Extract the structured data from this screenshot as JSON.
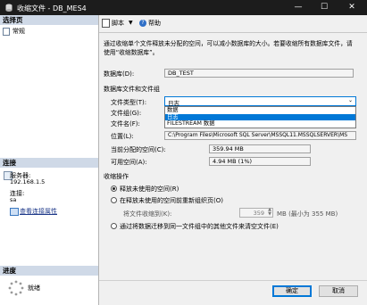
{
  "window": {
    "title": "收缩文件 - DB_MES4",
    "minimize": "—",
    "maximize": "☐",
    "close": "✕"
  },
  "left": {
    "select_page_header": "选择页",
    "pages": [
      {
        "label": "常规"
      }
    ],
    "connection_header": "连接",
    "server_label": "服务器:",
    "server_value": "192.168.1.5",
    "connection_label": "连接:",
    "connection_value": "sa",
    "view_connection_link": "查看连接属性",
    "progress_header": "进度",
    "progress_status": "就绪"
  },
  "toolbar": {
    "script_label": "脚本",
    "help_label": "帮助"
  },
  "main": {
    "description": "通过收缩单个文件释放未分配的空间，可以减小数据库的大小。若要收缩所有数据库文件，请使用“收缩数据库”。",
    "database_label": "数据库(D):",
    "database_value": "DB_TEST",
    "files_group_label": "数据库文件和文件组",
    "file_type_label": "文件类型(T):",
    "file_type_selected": "日志",
    "file_type_options": [
      "数据",
      "日志",
      "FILESTREAM 数据"
    ],
    "filegroup_label": "文件组(G):",
    "filename_label": "文件名(F):",
    "location_label": "位置(L):",
    "location_value": "C:\\Program Files\\Microsoft SQL Server\\MSSQL11.MSSQLSERVER\\MS",
    "allocated_label": "当前分配的空间(C):",
    "allocated_value": "359.94 MB",
    "available_label": "可用空间(A):",
    "available_value": "4.94 MB (1%)",
    "shrink_action_label": "收缩操作",
    "option_release": "释放未使用的空间(R)",
    "option_reorganize": "在释放未使用的空间前重新组织页(O)",
    "shrink_to_label": "将文件收缩到(K):",
    "shrink_to_value": "359",
    "shrink_to_hint": "MB (最小为 355 MB)",
    "option_empty": "通过将数据迁移到同一文件组中的其他文件来清空文件(E)"
  },
  "buttons": {
    "ok": "确定",
    "cancel": "取消"
  }
}
